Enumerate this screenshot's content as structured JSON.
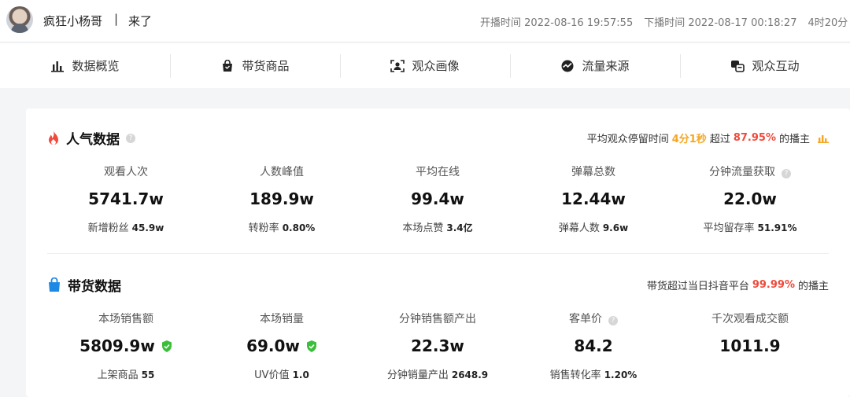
{
  "header": {
    "streamer_name": "疯狂小杨哥",
    "separator": "|",
    "status": "来了",
    "start_label": "开播时间",
    "start_time": "2022-08-16 19:57:55",
    "end_label": "下播时间",
    "end_time": "2022-08-17 00:18:27",
    "duration": "4时20分"
  },
  "tabs": [
    {
      "label": "数据概览",
      "icon": "bar-chart-icon"
    },
    {
      "label": "带货商品",
      "icon": "shopping-bag-icon"
    },
    {
      "label": "观众画像",
      "icon": "portrait-icon"
    },
    {
      "label": "流量来源",
      "icon": "traffic-icon"
    },
    {
      "label": "观众互动",
      "icon": "interaction-icon"
    }
  ],
  "popularity": {
    "title": "人气数据",
    "summary": {
      "prefix": "平均观众停留时间",
      "stay_time": "4分1秒",
      "mid": "超过",
      "percent": "87.95%",
      "suffix": "的播主"
    },
    "metrics": [
      {
        "label": "观看人次",
        "value": "5741.7w",
        "sub_label": "新增粉丝",
        "sub_value": "45.9w"
      },
      {
        "label": "人数峰值",
        "value": "189.9w",
        "sub_label": "转粉率",
        "sub_value": "0.80%"
      },
      {
        "label": "平均在线",
        "value": "99.4w",
        "sub_label": "本场点赞",
        "sub_value": "3.4亿"
      },
      {
        "label": "弹幕总数",
        "value": "12.44w",
        "sub_label": "弹幕人数",
        "sub_value": "9.6w"
      },
      {
        "label": "分钟流量获取",
        "value": "22.0w",
        "sub_label": "平均留存率",
        "sub_value": "51.91%"
      }
    ]
  },
  "sales": {
    "title": "带货数据",
    "summary": {
      "prefix": "带货超过当日抖音平台",
      "percent": "99.99%",
      "suffix": "的播主"
    },
    "metrics": [
      {
        "label": "本场销售额",
        "value": "5809.9w",
        "sub_label": "上架商品",
        "sub_value": "55"
      },
      {
        "label": "本场销量",
        "value": "69.0w",
        "sub_label": "UV价值",
        "sub_value": "1.0"
      },
      {
        "label": "分钟销售额产出",
        "value": "22.3w",
        "sub_label": "分钟销量产出",
        "sub_value": "2648.9"
      },
      {
        "label": "客单价",
        "value": "84.2",
        "sub_label": "销售转化率",
        "sub_value": "1.20%"
      },
      {
        "label": "千次观看成交额",
        "value": "1011.9",
        "sub_label": "",
        "sub_value": ""
      }
    ]
  },
  "colors": {
    "accent_orange": "#f5a623",
    "accent_red": "#f04a3a",
    "verified_green": "#3bbf3b",
    "bag_blue": "#1e88e5",
    "flame_red": "#f04a3a"
  }
}
